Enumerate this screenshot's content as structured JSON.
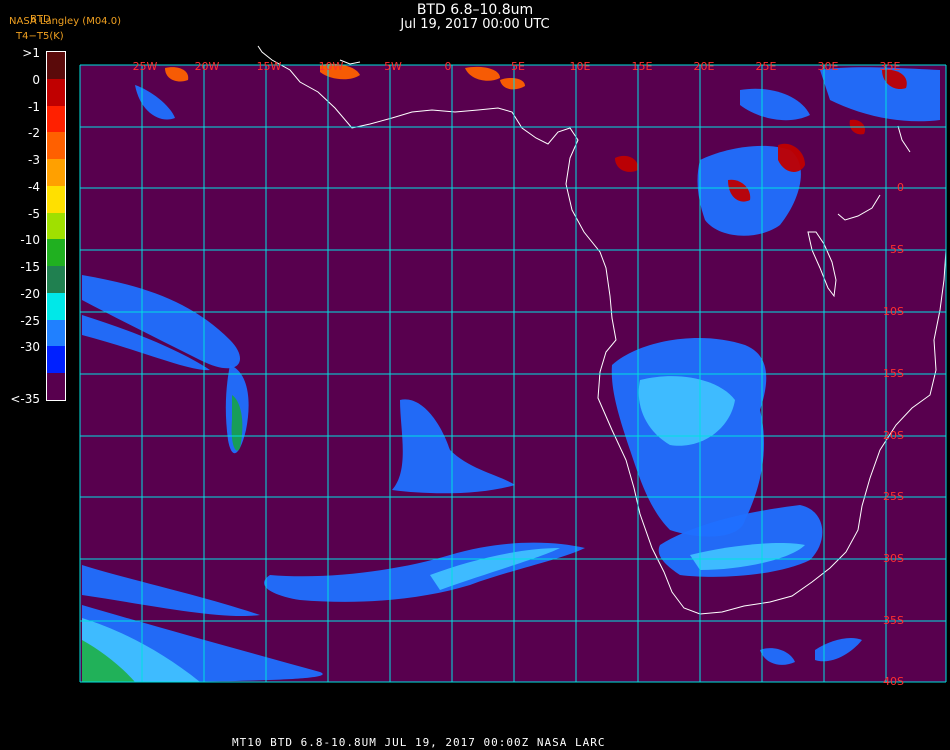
{
  "title": "BTD 6.8–10.8um",
  "subtitle": "Jul 19, 2017 00:00 UTC",
  "credit_line1": "NASA Langley (M04.0)",
  "credit_line2": "T4−T5(K)",
  "credit_overprint": "BTD",
  "footer": "MT10  BTD 6.8-10.8UM   JUL 19, 2017 00:00Z  NASA LARC",
  "colorbar": {
    "labels": [
      ">1",
      "0",
      "-1",
      "-2",
      "-3",
      "-4",
      "-5",
      "-10",
      "-15",
      "-20",
      "-25",
      "-30",
      "<-35"
    ],
    "colors": [
      "#5a0a0a",
      "#c00000",
      "#ff2000",
      "#ff6000",
      "#ffa000",
      "#ffe000",
      "#a0e000",
      "#20b020",
      "#208050",
      "#00e8e8",
      "#2080ff",
      "#0020ff",
      "#58004e"
    ]
  },
  "map": {
    "background_color": "#58004e",
    "grid_color": "#00e0e0",
    "label_color": "#ff3030",
    "lon_labels": [
      "25W",
      "20W",
      "15W",
      "10W",
      "5W",
      "0",
      "5E",
      "10E",
      "15E",
      "20E",
      "25E",
      "30E",
      "35E"
    ],
    "lat_labels": [
      "0",
      "5S",
      "10S",
      "15S",
      "20S",
      "25S",
      "30S",
      "35S",
      "40S"
    ]
  }
}
